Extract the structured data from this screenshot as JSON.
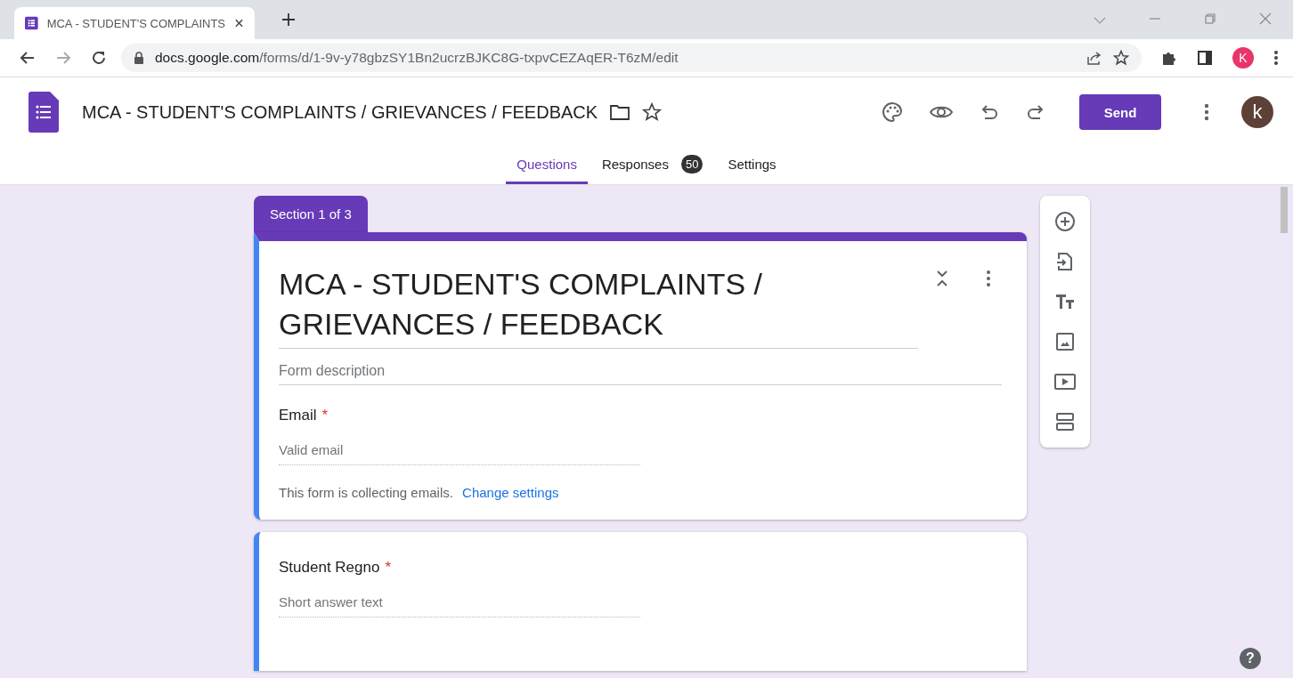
{
  "browser": {
    "tab_title": "MCA - STUDENT'S COMPLAINTS",
    "url_domain": "docs.google.com",
    "url_path": "/forms/d/1-9v-y78gbzSY1Bn2ucrzBJKC8G-txpvCEZAqER-T6zM/edit",
    "profile_initial": "K"
  },
  "header": {
    "title": "MCA - STUDENT'S COMPLAINTS / GRIEVANCES / FEEDBACK",
    "send": "Send",
    "avatar_initial": "k"
  },
  "tabs": [
    {
      "label": "Questions",
      "selected": true
    },
    {
      "label": "Responses",
      "selected": false,
      "badge": "50"
    },
    {
      "label": "Settings",
      "selected": false
    }
  ],
  "section_tag": "Section 1 of 3",
  "form_card": {
    "title": "MCA - STUDENT'S COMPLAINTS / GRIEVANCES / FEEDBACK",
    "description_placeholder": "Form description",
    "email": {
      "label": "Email",
      "required_mark": "*",
      "placeholder": "Valid email",
      "note": "This form is collecting emails.",
      "link": "Change settings"
    }
  },
  "questions": [
    {
      "title": "Student Regno",
      "required_mark": "*",
      "placeholder": "Short answer text"
    }
  ],
  "help": "?"
}
